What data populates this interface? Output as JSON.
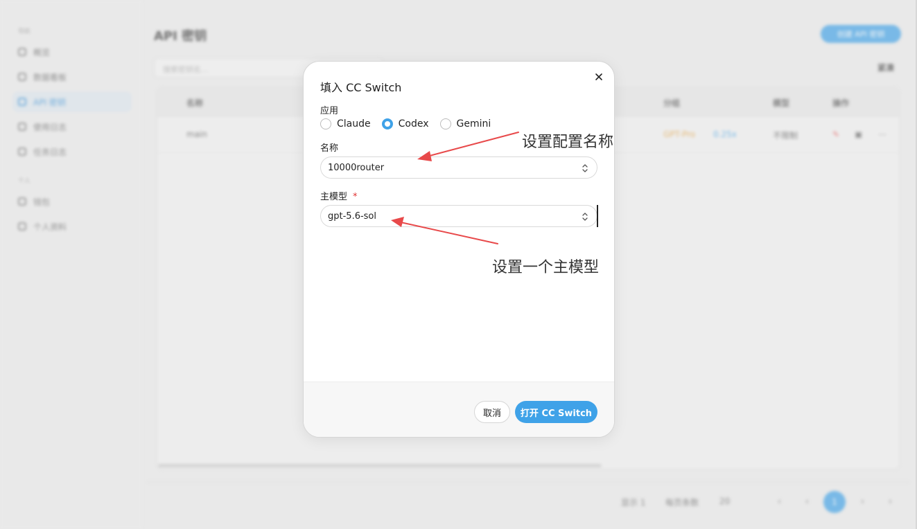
{
  "background": {
    "sidebar": {
      "section1": "导航",
      "items": [
        {
          "label": "概览"
        },
        {
          "label": "数据看板"
        },
        {
          "label": "API 密钥"
        },
        {
          "label": "使用日志"
        },
        {
          "label": "任务日志"
        }
      ],
      "section2": "个人",
      "items2": [
        {
          "label": "钱包"
        },
        {
          "label": "个人资料"
        }
      ]
    },
    "page_title": "API 密钥",
    "create_button": "创建 API 密钥",
    "search_placeholder": "搜索密钥名...",
    "toggle_label": "紧凑",
    "table": {
      "headers": [
        "名称",
        "分组",
        "模型",
        "操作"
      ],
      "row": {
        "name": "main",
        "tag1": "GPT-Pro",
        "tag2": "0.25x",
        "model": "不限制"
      }
    },
    "pager": {
      "total": "显示 1",
      "per_page": "每页条数",
      "size": "20",
      "current": "1"
    }
  },
  "modal": {
    "title": "填入 CC Switch",
    "app_label": "应用",
    "apps": [
      {
        "label": "Claude",
        "selected": false
      },
      {
        "label": "Codex",
        "selected": true
      },
      {
        "label": "Gemini",
        "selected": false
      }
    ],
    "name_label": "名称",
    "name_value": "10000router",
    "model_label": "主模型",
    "required_mark": "*",
    "model_value": "gpt-5.6-sol",
    "cancel_label": "取消",
    "submit_label": "打开 CC Switch"
  },
  "annotations": {
    "name_hint": "设置配置名称",
    "model_hint": "设置一个主模型",
    "arrow_color": "#e8494a"
  },
  "colors": {
    "accent": "#3fa2e8",
    "required": "#e03131"
  }
}
